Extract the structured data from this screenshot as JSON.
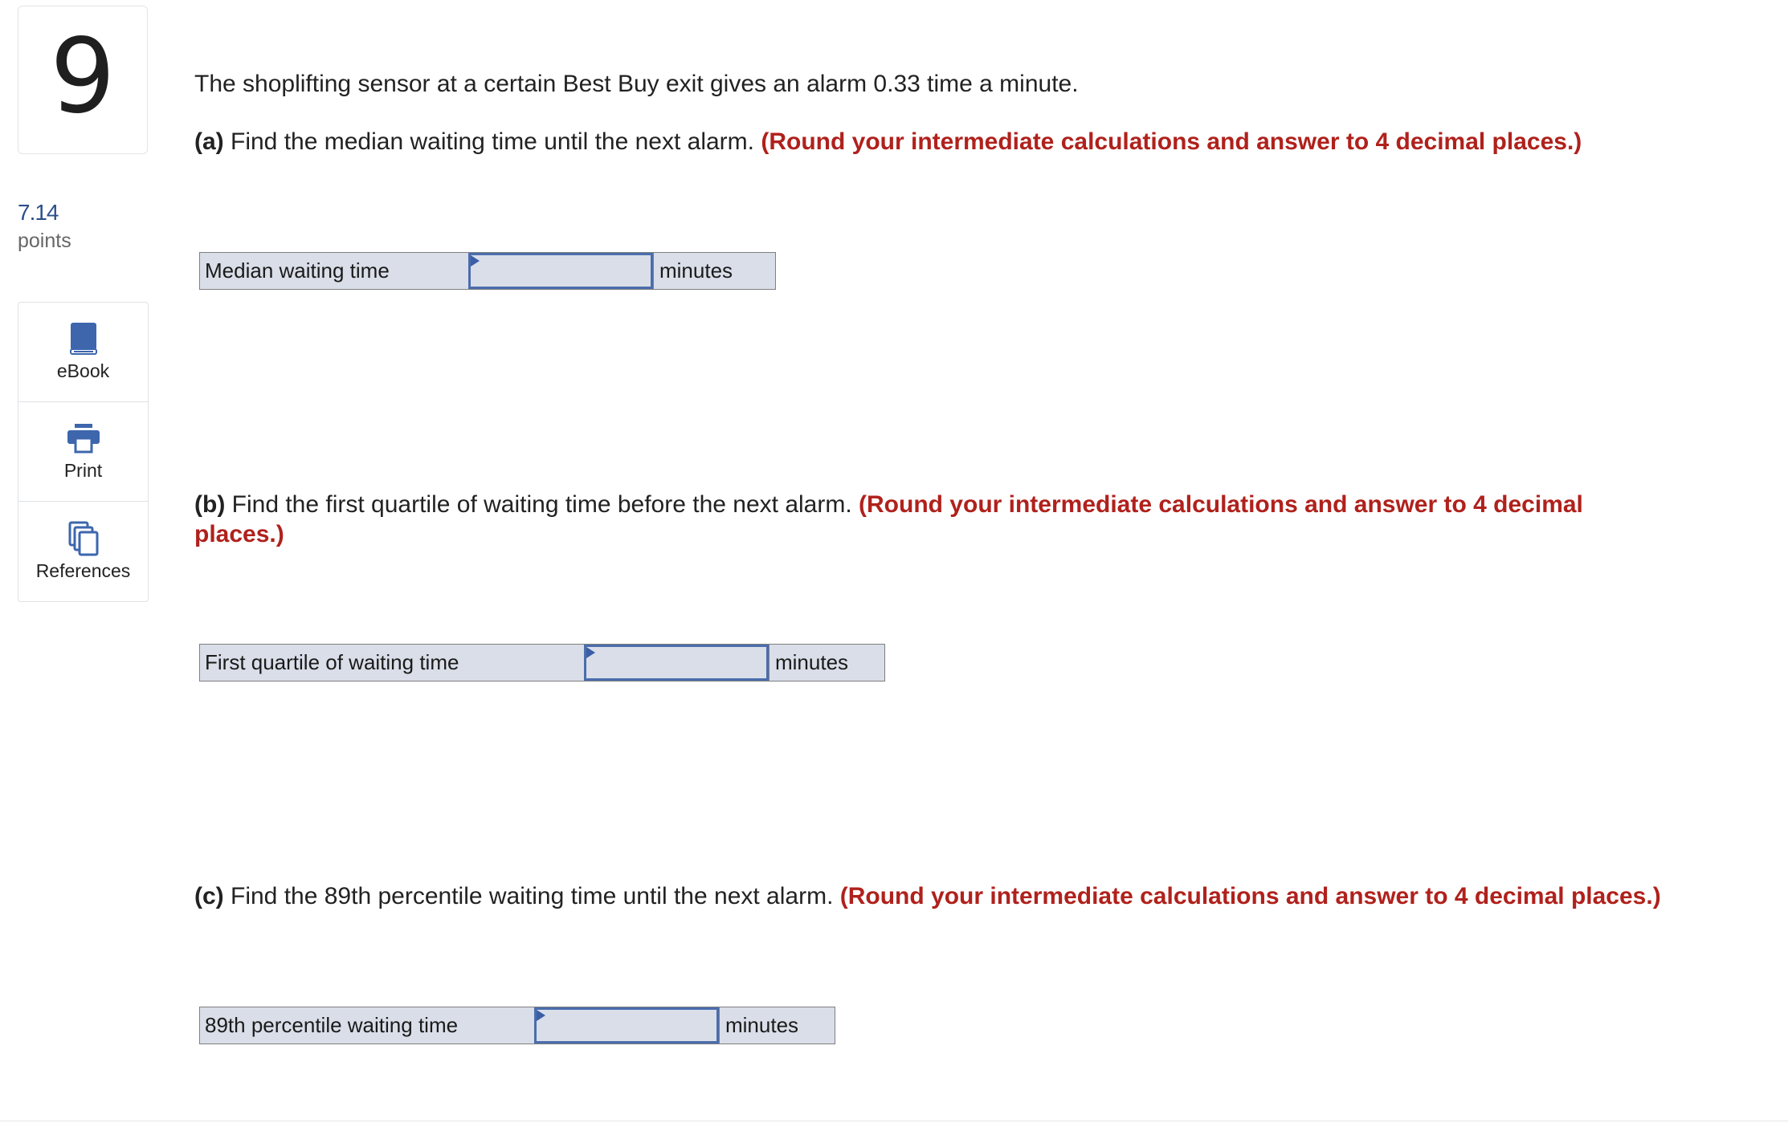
{
  "question": {
    "number": "9",
    "points_value": "7.14",
    "points_label": "points",
    "stem": "The shoplifting sensor at a certain Best Buy exit gives an alarm 0.33 time a minute."
  },
  "tools": [
    {
      "label": "eBook",
      "icon": "book-icon"
    },
    {
      "label": "Print",
      "icon": "printer-icon"
    },
    {
      "label": "References",
      "icon": "copy-pages-icon"
    }
  ],
  "parts": [
    {
      "letter": "(a)",
      "text": " Find the median waiting time until the next alarm. ",
      "hint": "(Round your intermediate calculations and answer to 4 decimal places.)",
      "answer_label": "Median waiting time",
      "answer_value": "",
      "unit": "minutes"
    },
    {
      "letter": "(b)",
      "text": " Find the first quartile of waiting time before the next alarm. ",
      "hint": "(Round your intermediate calculations and answer to 4 decimal places.)",
      "answer_label": "First quartile of waiting time",
      "answer_value": "",
      "unit": "minutes"
    },
    {
      "letter": "(c)",
      "text": " Find the 89th percentile waiting time until the next alarm. ",
      "hint": "(Round your intermediate calculations and answer to 4 decimal places.)",
      "answer_label": "89th percentile waiting time",
      "answer_value": "",
      "unit": "minutes"
    }
  ],
  "colors": {
    "hint": "#b0211c",
    "points": "#2c4f8a",
    "icon": "#3d66ad",
    "input_border": "#4b6dad",
    "answer_bg": "#d9dee8"
  }
}
